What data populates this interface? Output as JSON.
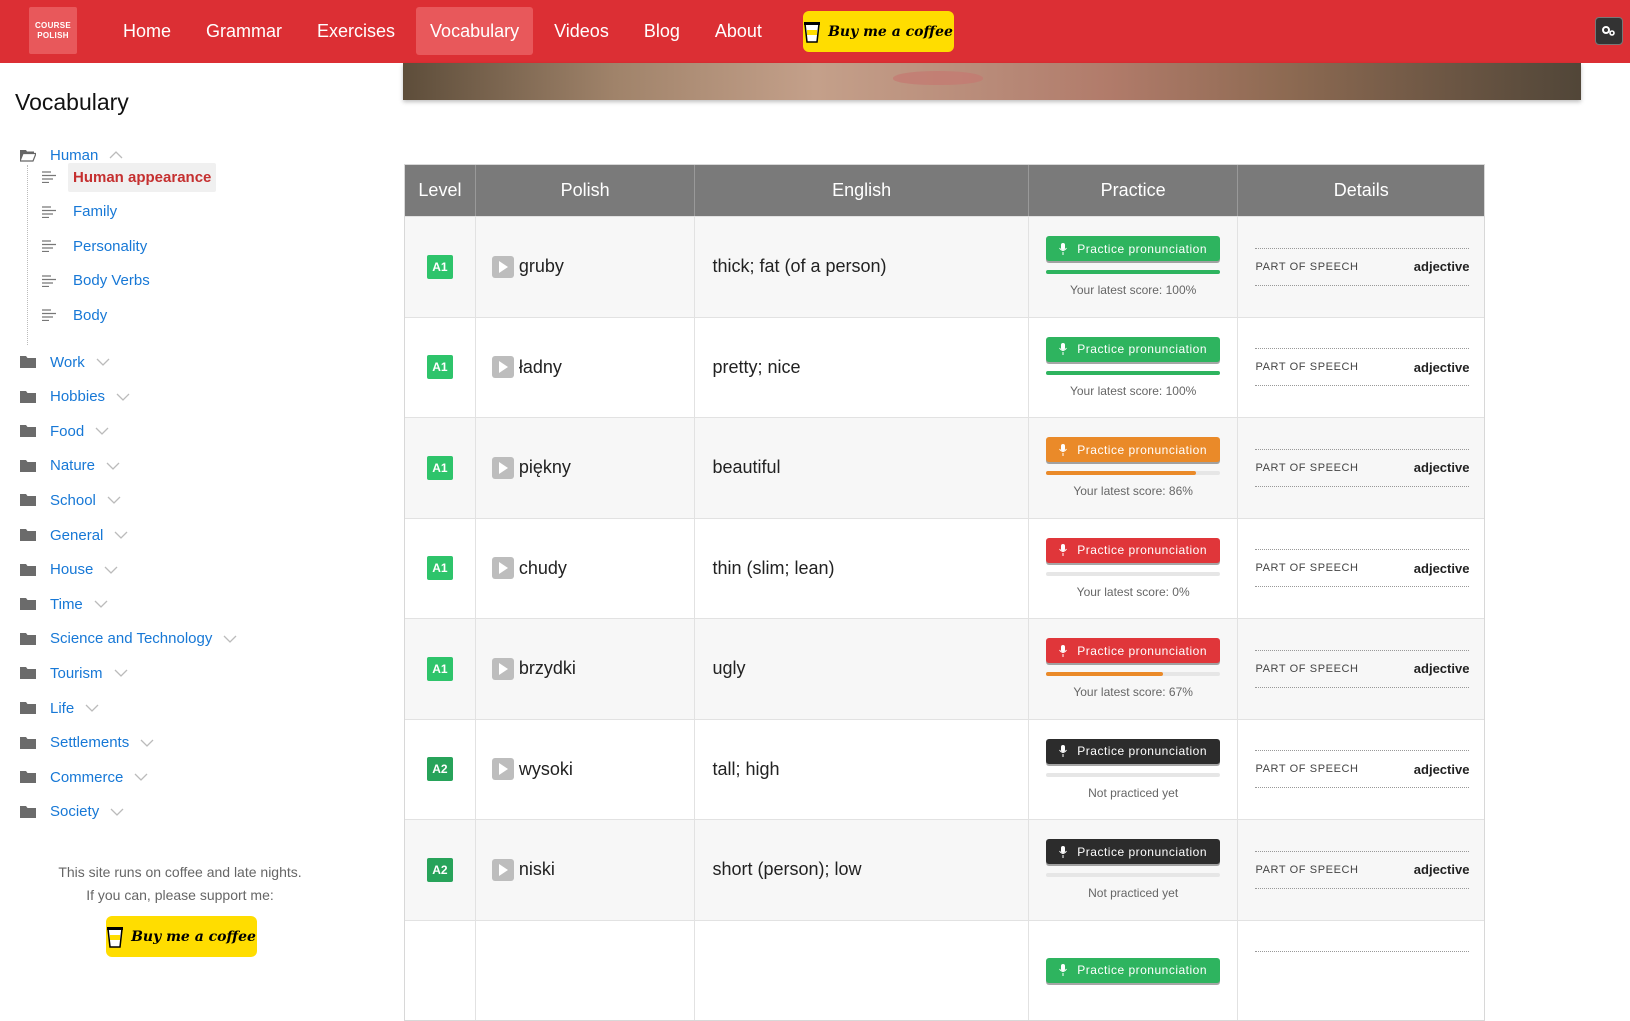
{
  "navbar": {
    "logo_line1": "COURSE",
    "logo_line2": "POLISH",
    "items": [
      {
        "label": "Home",
        "active": false
      },
      {
        "label": "Grammar",
        "active": false
      },
      {
        "label": "Exercises",
        "active": false
      },
      {
        "label": "Vocabulary",
        "active": true
      },
      {
        "label": "Videos",
        "active": false
      },
      {
        "label": "Blog",
        "active": false
      },
      {
        "label": "About",
        "active": false
      }
    ],
    "coffee_label": "Buy me a coffee",
    "accent": "#dc2f34"
  },
  "sidebar": {
    "title": "Vocabulary",
    "open_category": "Human",
    "subcategories": [
      {
        "label": "Human appearance",
        "active": true
      },
      {
        "label": "Family",
        "active": false
      },
      {
        "label": "Personality",
        "active": false
      },
      {
        "label": "Body Verbs",
        "active": false
      },
      {
        "label": "Body",
        "active": false
      }
    ],
    "categories": [
      "Work",
      "Hobbies",
      "Food",
      "Nature",
      "School",
      "General",
      "House",
      "Time",
      "Science and Technology",
      "Tourism",
      "Life",
      "Settlements",
      "Commerce",
      "Society"
    ],
    "support_line1": "This site runs on coffee and late nights.",
    "support_line2": "If you can, please support me:",
    "coffee_label": "Buy me a coffee"
  },
  "table": {
    "headers": {
      "level": "Level",
      "polish": "Polish",
      "english": "English",
      "practice": "Practice",
      "details": "Details"
    },
    "practice_label": "Practice pronunciation",
    "pos_label": "PART OF SPEECH",
    "rows": [
      {
        "level": "A1",
        "polish": "gruby",
        "english": "thick; fat (of a person)",
        "score": 1.0,
        "btn": "green",
        "score_text": "Your latest score: 100%",
        "pos": "adjective"
      },
      {
        "level": "A1",
        "polish": "ładny",
        "english": "pretty; nice",
        "score": 1.0,
        "btn": "green",
        "score_text": "Your latest score: 100%",
        "pos": "adjective"
      },
      {
        "level": "A1",
        "polish": "piękny",
        "english": "beautiful",
        "score": 0.86,
        "btn": "orange",
        "score_text": "Your latest score: 86%",
        "pos": "adjective"
      },
      {
        "level": "A1",
        "polish": "chudy",
        "english": "thin (slim; lean)",
        "score": 0.0,
        "btn": "red",
        "score_text": "Your latest score: 0%",
        "pos": "adjective"
      },
      {
        "level": "A1",
        "polish": "brzydki",
        "english": "ugly",
        "score": 0.67,
        "btn": "red",
        "score_text": "Your latest score: 67%",
        "pos": "adjective"
      },
      {
        "level": "A2",
        "polish": "wysoki",
        "english": "tall; high",
        "score": 0.0,
        "btn": "dark",
        "score_text": "Not practiced yet",
        "pos": "adjective"
      },
      {
        "level": "A2",
        "polish": "niski",
        "english": "short (person); low",
        "score": 0.0,
        "btn": "dark",
        "score_text": "Not practiced yet",
        "pos": "adjective"
      },
      {
        "level": "",
        "polish": "",
        "english": "",
        "score": 0.0,
        "btn": "green",
        "score_text": "",
        "pos": ""
      }
    ]
  },
  "colors": {
    "green": "#2eb45f",
    "orange": "#ea8a29",
    "red": "#e0363a",
    "dark": "#2c2c2c",
    "link": "#1778d6"
  }
}
